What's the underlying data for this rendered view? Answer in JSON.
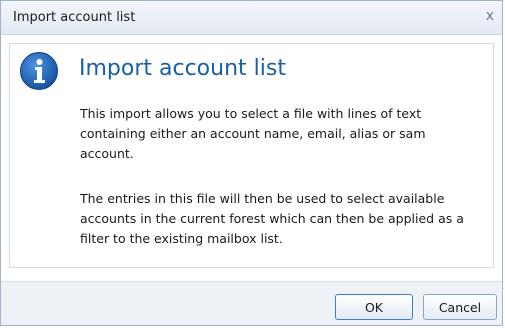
{
  "dialog": {
    "title": "Import account list",
    "close_label": "x",
    "heading": "Import account list",
    "paragraph1": "This import allows you to select a file with lines of text containing either an account name, email, alias or sam account.",
    "paragraph2": "The entries in this file will then be used to select available accounts in the current forest which can then be applied as a filter to the existing mailbox list."
  },
  "buttons": {
    "ok_label": "OK",
    "cancel_label": "Cancel"
  },
  "icon": "info-icon",
  "colors": {
    "heading": "#1a5fa8",
    "icon_fill": "#1f64b8"
  }
}
